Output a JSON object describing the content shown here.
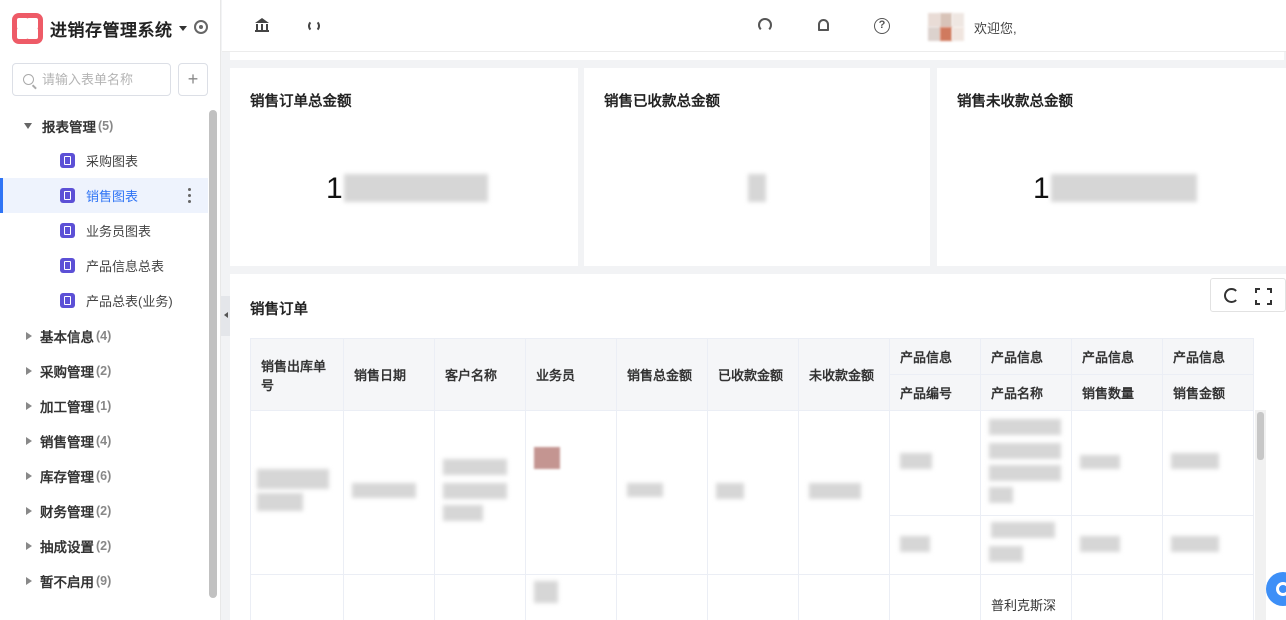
{
  "app": {
    "title": "进销存管理系统"
  },
  "sidebar": {
    "search_placeholder": "请输入表单名称",
    "add_label": "+",
    "groups": [
      {
        "label": "报表管理",
        "count": "(5)",
        "expanded": true,
        "items": [
          {
            "label": "采购图表"
          },
          {
            "label": "销售图表",
            "active": true
          },
          {
            "label": "业务员图表"
          },
          {
            "label": "产品信息总表"
          },
          {
            "label": "产品总表(业务)"
          }
        ]
      },
      {
        "label": "基本信息",
        "count": "(4)"
      },
      {
        "label": "采购管理",
        "count": "(2)"
      },
      {
        "label": "加工管理",
        "count": "(1)"
      },
      {
        "label": "销售管理",
        "count": "(4)"
      },
      {
        "label": "库存管理",
        "count": "(6)"
      },
      {
        "label": "财务管理",
        "count": "(2)"
      },
      {
        "label": "抽成设置",
        "count": "(2)"
      },
      {
        "label": "暂不启用",
        "count": "(9)"
      }
    ]
  },
  "topbar": {
    "welcome": "欢迎您,"
  },
  "cards": [
    {
      "title": "销售订单总金额",
      "value_prefix": "1"
    },
    {
      "title": "销售已收款总金额",
      "value_prefix": ""
    },
    {
      "title": "销售未收款总金额",
      "value_prefix": "1"
    }
  ],
  "table": {
    "title": "销售订单",
    "headers": {
      "order_no": "销售出库单号",
      "date": "销售日期",
      "customer": "客户名称",
      "salesman": "业务员",
      "total": "销售总金额",
      "received": "已收款金额",
      "unreceived": "未收款金额",
      "group": "产品信息",
      "product_code": "产品编号",
      "product_name": "产品名称",
      "quantity": "销售数量",
      "amount": "销售金额"
    },
    "visible_text": {
      "row2_product_name": "普利克斯深"
    }
  },
  "colors": {
    "accent": "#2f74f5",
    "logo": "#ee5b67",
    "doc_icon": "#5c50d6"
  }
}
